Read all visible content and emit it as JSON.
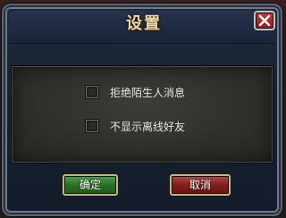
{
  "dialog": {
    "title": "设置",
    "close_icon": "close-x-icon"
  },
  "options": [
    {
      "label": "拒绝陌生人消息",
      "checked": false
    },
    {
      "label": "不显示离线好友",
      "checked": false
    }
  ],
  "buttons": {
    "ok_label": "确定",
    "cancel_label": "取消"
  },
  "colors": {
    "title": "#f0d9a8",
    "ok_button": "#2a6b27",
    "cancel_button": "#7e1c1a",
    "close_button": "#c23b3b"
  }
}
